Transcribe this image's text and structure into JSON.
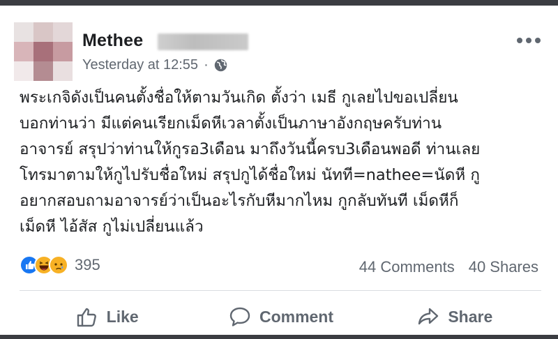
{
  "post": {
    "author": "Methee",
    "timestamp": "Yesterday at 12:55",
    "separator": "·",
    "privacy_icon": "globe-icon",
    "menu_icon": "more-options-icon",
    "text_lines": [
      "พระเกจิดังเป็นคนตั้งชื่อให้ตามวันเกิด ตั้งว่า เมธี กูเลยไปขอเปลี่ยน",
      "บอกท่านว่า มีแต่คนเรียกเม็ดหีเวลาตั้งเป็นภาษาอังกฤษครับท่าน",
      "อาจารย์ สรุปว่าท่านให้กูรอ3เดือน มาถึงวันนี้ครบ3เดือนพอดี ท่านเลย",
      "โทรมาตามให้กูไปรับชื่อใหม่ สรุปกูได้ชื่อใหม่ นัทที=nathee=นัดหี กู",
      "อยากสอบถามอาจารย์ว่าเป็นอะไรกับหีมากไหม กูกลับทันที เม็ดหีก็",
      "เม็ดหี ไอ้สัส กูไม่เปลี่ยนแล้ว"
    ]
  },
  "stats": {
    "reactions": [
      "like",
      "haha",
      "sad"
    ],
    "reaction_count": "395",
    "comments": "44 Comments",
    "shares": "40 Shares"
  },
  "actions": {
    "like": "Like",
    "comment": "Comment",
    "share": "Share"
  },
  "colors": {
    "text": "#1c1e21",
    "secondary": "#606770",
    "like_blue": "#1877f2",
    "reaction_yellow": "#f7b125",
    "divider": "#dadde1"
  }
}
